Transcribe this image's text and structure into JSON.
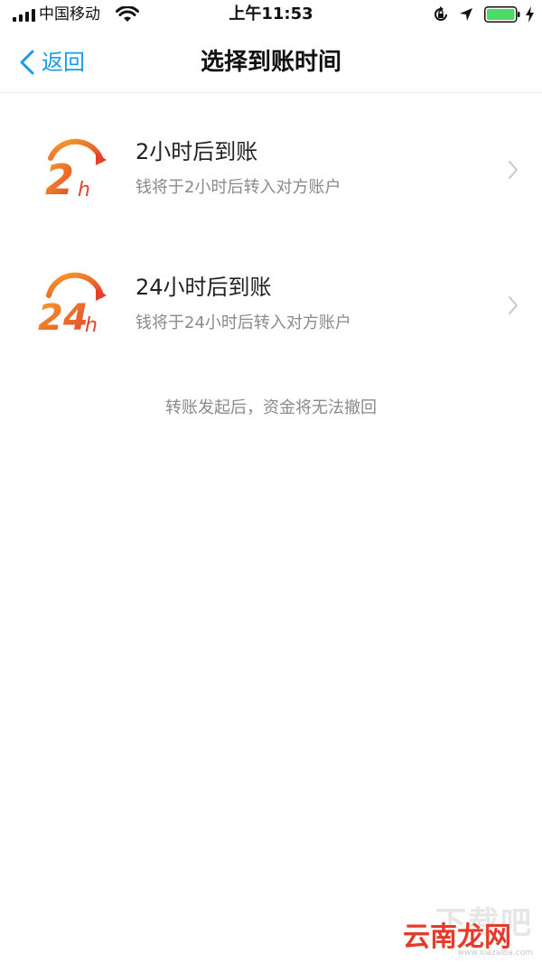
{
  "status_bar": {
    "carrier": "中国移动",
    "time": "上午11:53",
    "battery_color": "#4cd964"
  },
  "nav": {
    "back_label": "返回",
    "title": "选择到账时间",
    "accent_color": "#1a9be8"
  },
  "options": [
    {
      "icon_text": "2h",
      "title": "2小时后到账",
      "description": "钱将于2小时后转入对方账户"
    },
    {
      "icon_text": "24h",
      "title": "24小时后到账",
      "description": "钱将于24小时后转入对方账户"
    }
  ],
  "notice": "转账发起后，资金将无法撤回",
  "watermark": {
    "top": "下载吧",
    "main": "云南龙网",
    "url": "www.xiazaiba.com"
  },
  "icons": {
    "back": "chevron-left-icon",
    "row": "chevron-right-icon",
    "option_icon_color": "#e8552a"
  }
}
